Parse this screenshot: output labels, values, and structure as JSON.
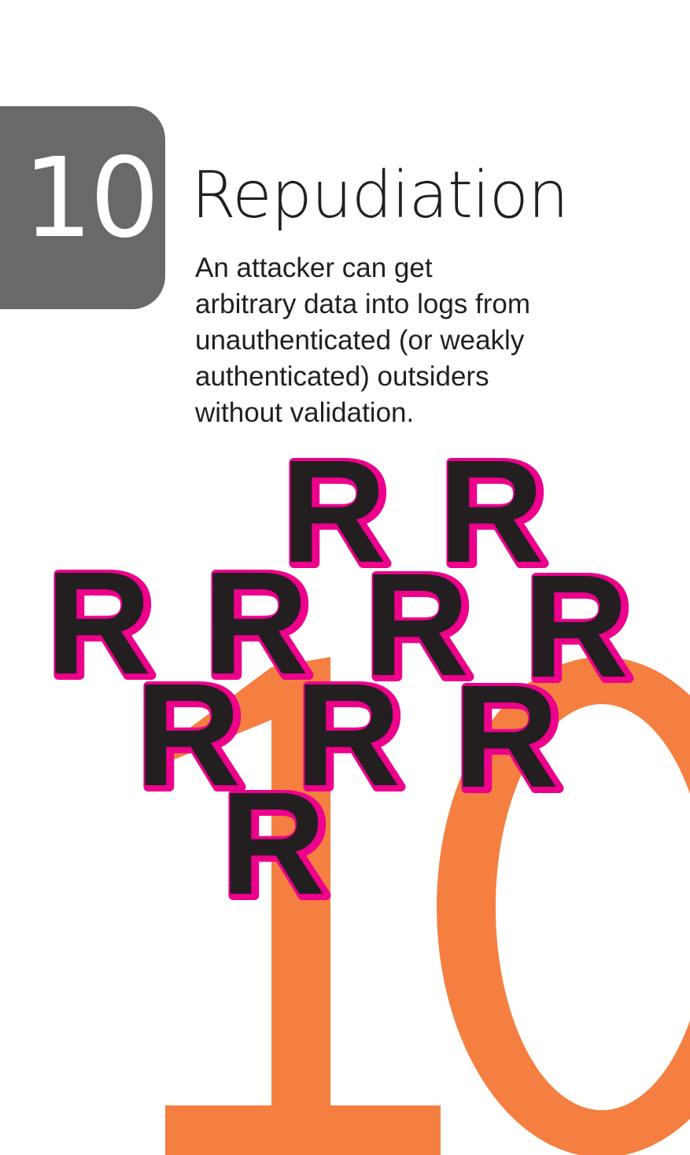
{
  "card": {
    "number": "10",
    "title": "Repudiation",
    "description_lines": [
      "An attacker can get",
      "arbitrary data into logs from",
      "unauthenticated (or weakly",
      "authenticated) outsiders",
      "without validation."
    ],
    "glyph": "R",
    "colors": {
      "badge": "#6a6969",
      "orange": "#f57f40",
      "pink": "#ec008c",
      "dark": "#231f20"
    }
  }
}
